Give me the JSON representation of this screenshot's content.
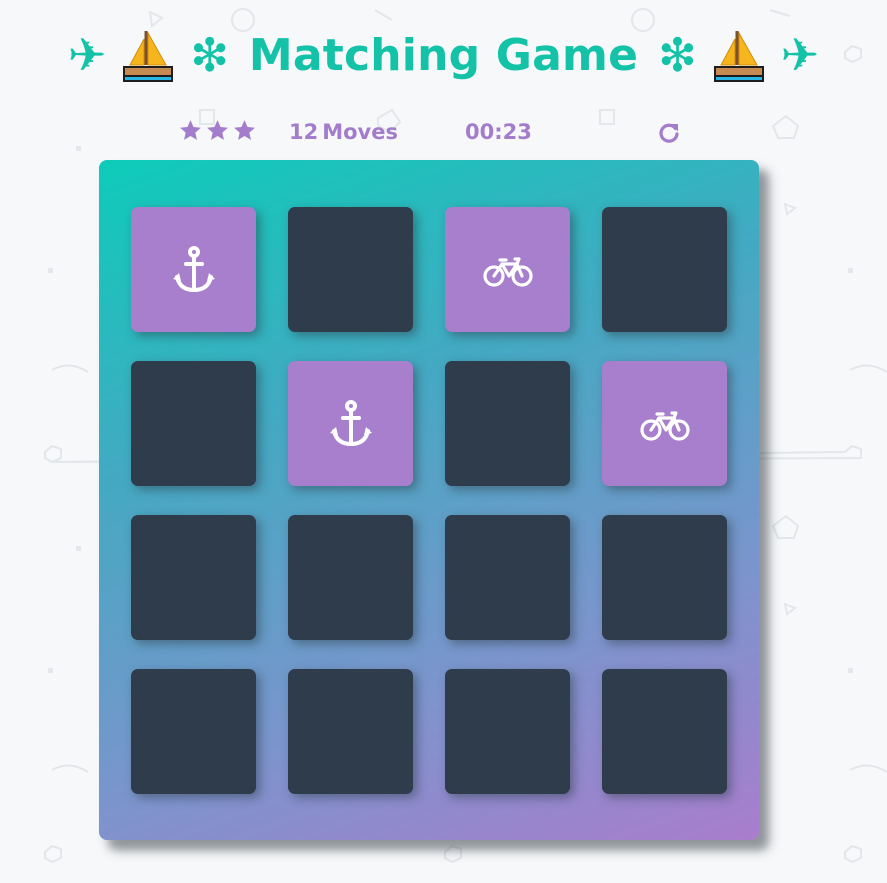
{
  "title": {
    "left_plane": "✈",
    "left_sparkle": "❇",
    "text": "Matching Game",
    "right_sparkle": "❇",
    "right_plane": "✈",
    "accent_color": "#14c2a8"
  },
  "score_panel": {
    "stars": 3,
    "moves_count": "12",
    "moves_label": "Moves",
    "timer": "00:23",
    "color": "#a37ccb"
  },
  "deck": {
    "rows": 4,
    "cols": 4,
    "card_back_color": "#2f3c4b",
    "card_open_color": "#a77fcc",
    "cards": [
      {
        "state": "open",
        "icon": "anchor-icon"
      },
      {
        "state": "closed",
        "icon": ""
      },
      {
        "state": "open",
        "icon": "bicycle-icon"
      },
      {
        "state": "closed",
        "icon": ""
      },
      {
        "state": "closed",
        "icon": ""
      },
      {
        "state": "open",
        "icon": "anchor-icon"
      },
      {
        "state": "closed",
        "icon": ""
      },
      {
        "state": "open",
        "icon": "bicycle-icon"
      },
      {
        "state": "closed",
        "icon": ""
      },
      {
        "state": "closed",
        "icon": ""
      },
      {
        "state": "closed",
        "icon": ""
      },
      {
        "state": "closed",
        "icon": ""
      },
      {
        "state": "closed",
        "icon": ""
      },
      {
        "state": "closed",
        "icon": ""
      },
      {
        "state": "closed",
        "icon": ""
      },
      {
        "state": "closed",
        "icon": ""
      }
    ]
  }
}
